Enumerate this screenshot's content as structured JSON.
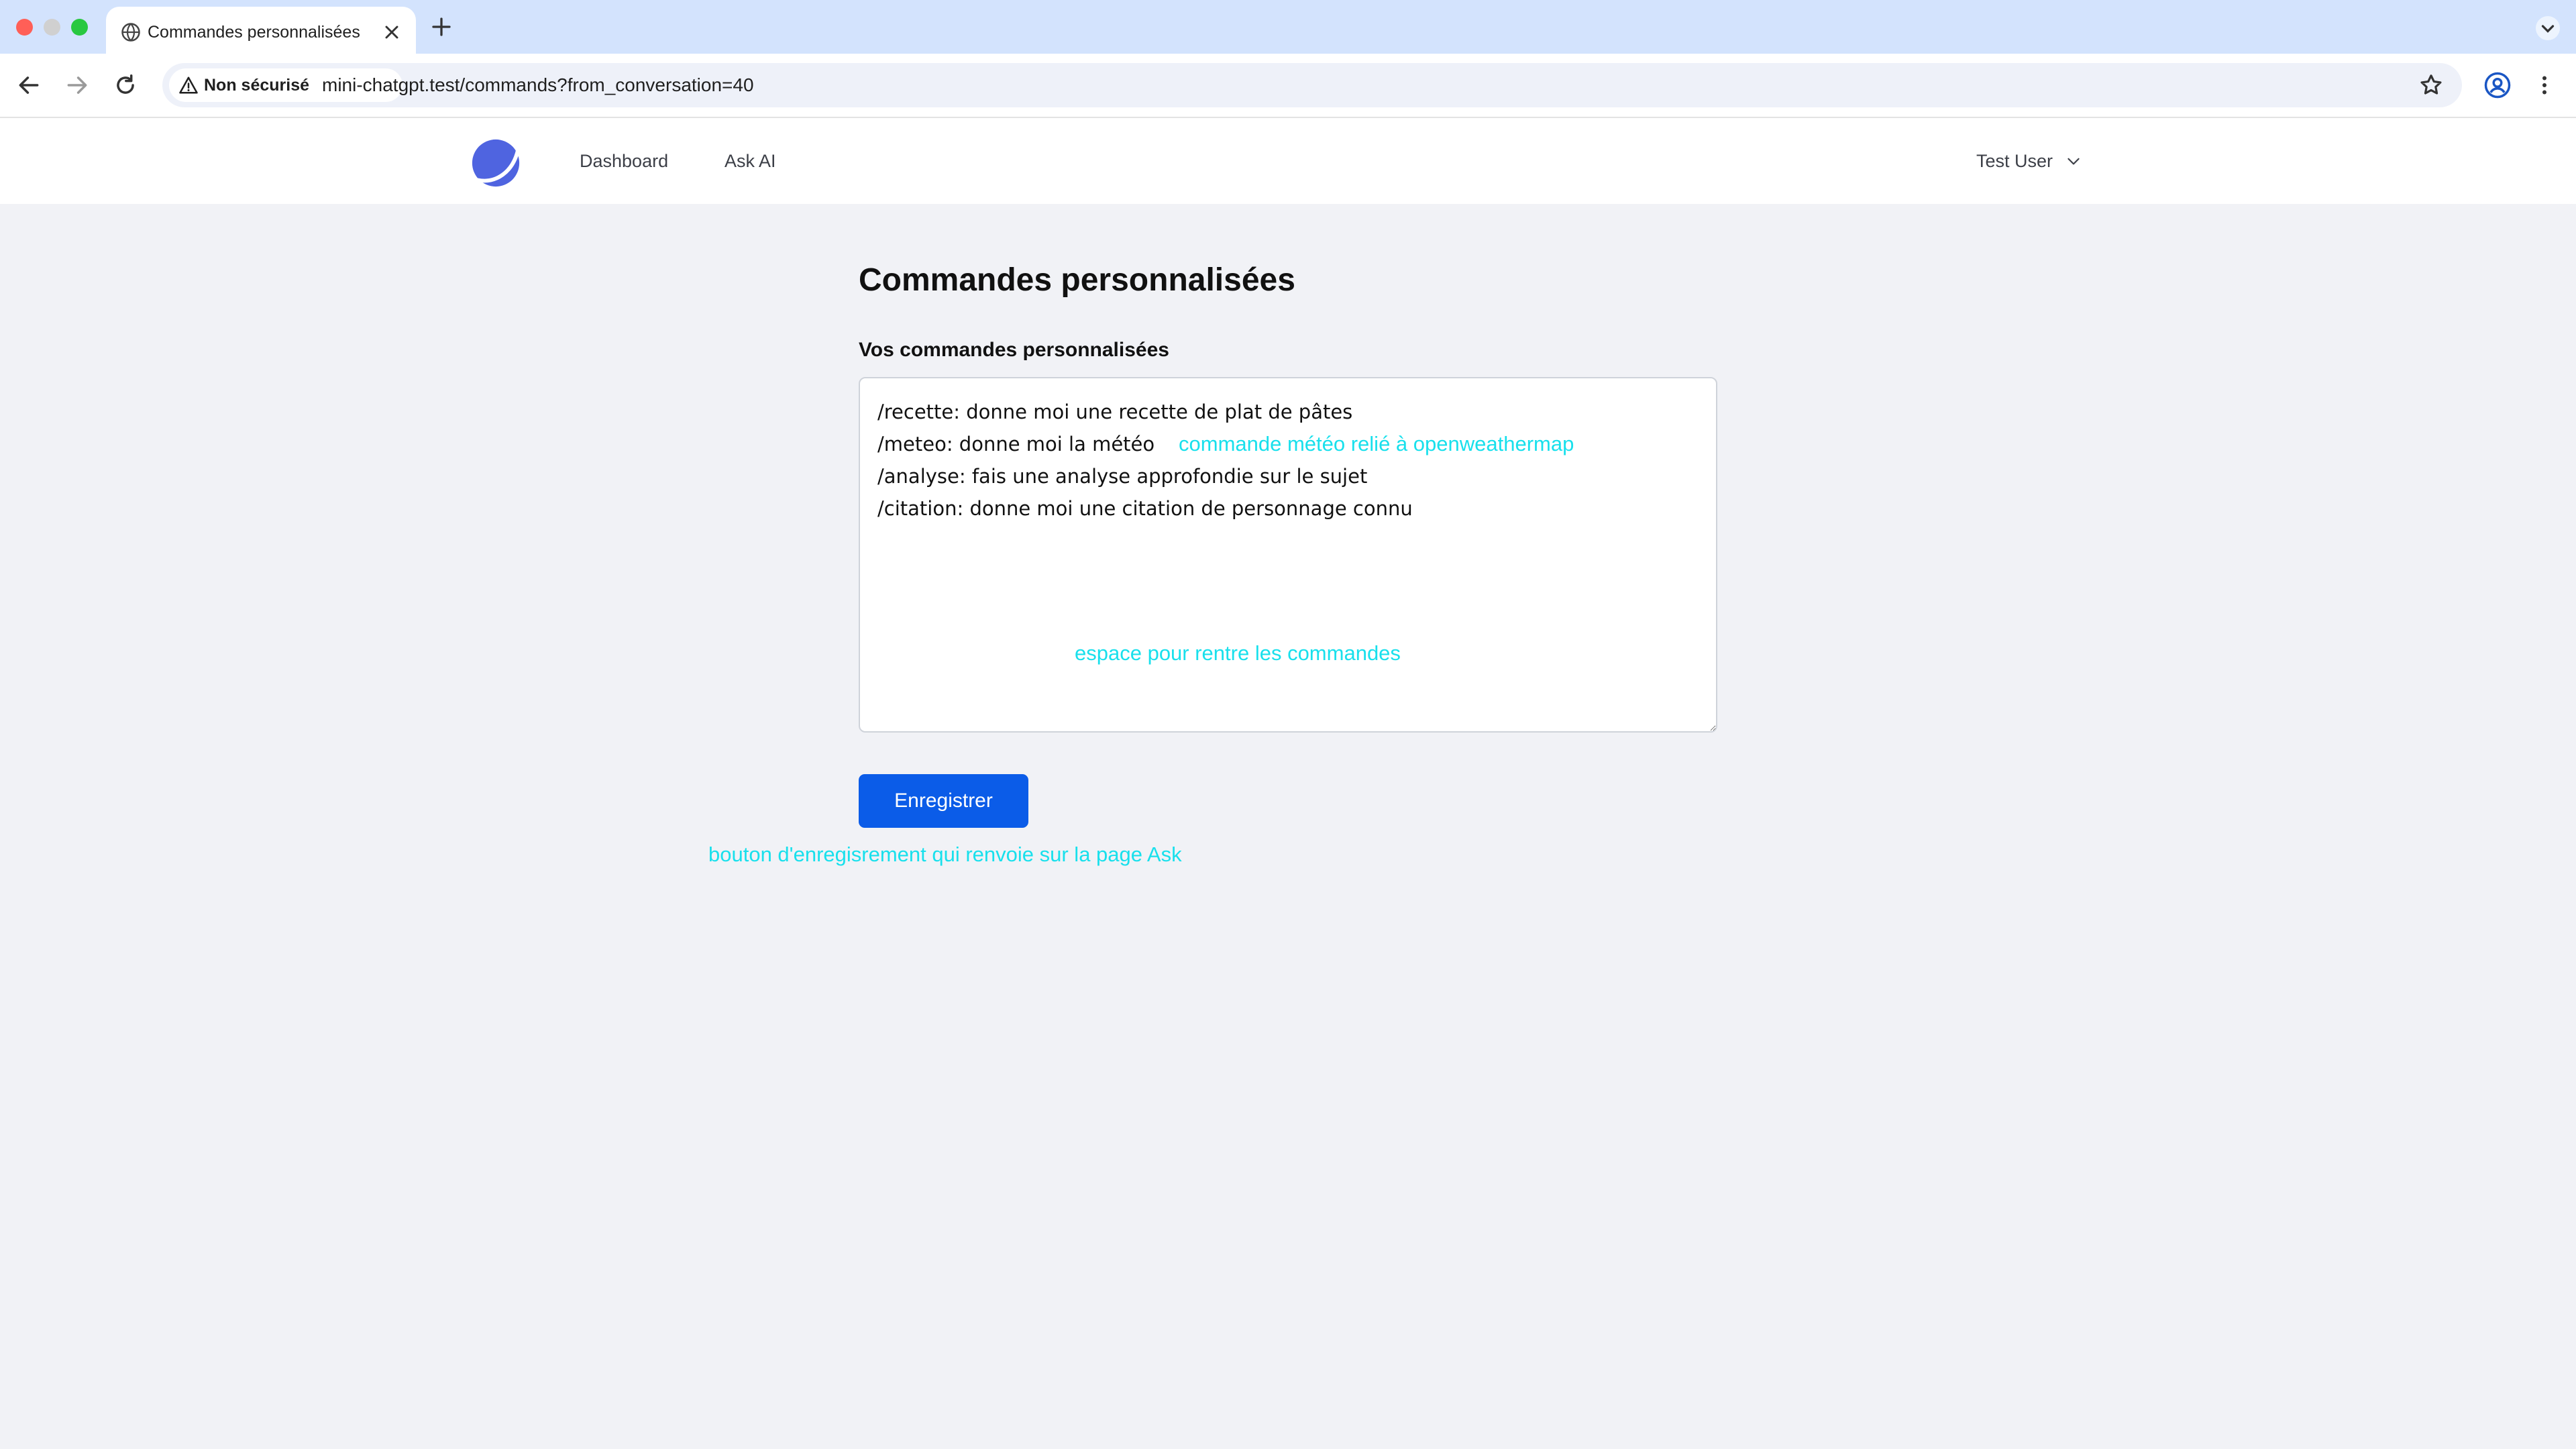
{
  "browser": {
    "tab_title": "Commandes personnalisées",
    "security_label": "Non sécurisé",
    "url": "mini-chatgpt.test/commands?from_conversation=40"
  },
  "header": {
    "nav": [
      "Dashboard",
      "Ask AI"
    ],
    "user_name": "Test User"
  },
  "main": {
    "title": "Commandes personnalisées",
    "field_label": "Vos commandes personnalisées",
    "commands_value": "/recette: donne moi une recette de plat de pâtes\n/meteo: donne moi la météo\n/analyse: fais une analyse approfondie sur le sujet\n/citation: donne moi une citation de personnage connu",
    "save_label": "Enregistrer"
  },
  "annotations": {
    "meteo": "commande météo relié à openweathermap",
    "space": "espace pour rentre les commandes",
    "save": "bouton d'enregisrement qui renvoie sur la page Ask"
  },
  "colors": {
    "accent": "#0b5ce8",
    "annotation": "#18e0ec",
    "page_background": "#f1f2f6",
    "tabbar": "#d3e3fd"
  }
}
